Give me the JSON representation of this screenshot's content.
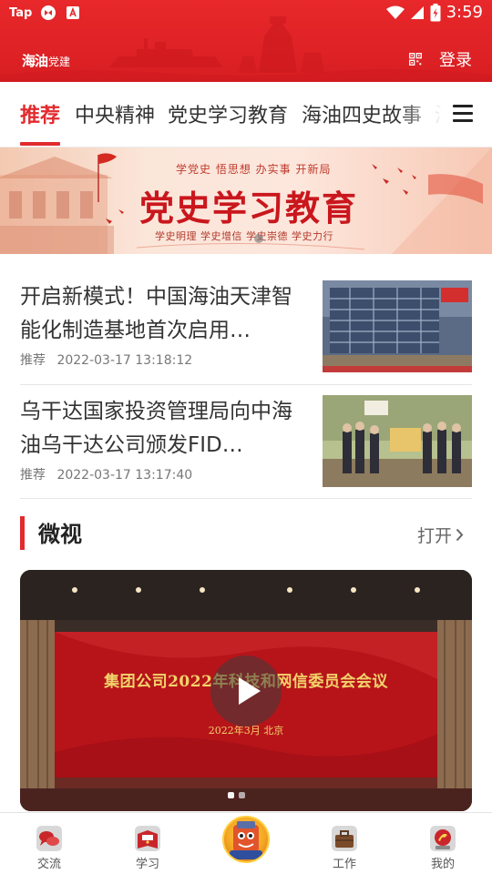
{
  "status_bar": {
    "carrier_text": "Tap",
    "time": "3:59",
    "icons": [
      "app-notification-icon",
      "text-a-icon",
      "wifi-icon",
      "signal-icon",
      "battery-charging-icon"
    ]
  },
  "header": {
    "logo_main": "海油",
    "logo_sub": "党建",
    "qr_icon": "qr-code-icon",
    "login_label": "登录",
    "color": "#e12b2f"
  },
  "tabs": {
    "items": [
      {
        "label": "推荐",
        "active": true
      },
      {
        "label": "中央精神",
        "active": false
      },
      {
        "label": "党史学习教育",
        "active": false
      },
      {
        "label": "海油四史故事",
        "active": false
      },
      {
        "label": "海",
        "active": false
      }
    ],
    "menu_icon": "hamburger-menu-icon",
    "accent": "#e12b2f"
  },
  "banner": {
    "slogan": "学党史  悟思想  办实事  开新局",
    "title": "党史学习教育",
    "subtitle": "学史明理  学史增信  学史崇德  学史力行"
  },
  "news": [
    {
      "title": "开启新模式！中国海油天津智能化制造基地首次启用…",
      "category": "推荐",
      "time": "2022-03-17 13:18:12"
    },
    {
      "title": "乌干达国家投资管理局向中海油乌干达公司颁发FID…",
      "category": "推荐",
      "time": "2022-03-17 13:17:40"
    }
  ],
  "section": {
    "title": "微视",
    "more_label": "打开"
  },
  "video": {
    "caption": "集团公司2022年科技和网信委员会会议",
    "subcaption": "2022年3月  北京",
    "slide_count": 2,
    "active_slide": 1
  },
  "bottom_nav": {
    "items": [
      {
        "label": "交流",
        "icon": "chat-bubbles-icon"
      },
      {
        "label": "学习",
        "icon": "party-book-icon"
      },
      {
        "label": "",
        "icon": "center-cartoon-icon"
      },
      {
        "label": "工作",
        "icon": "work-toolbox-icon"
      },
      {
        "label": "我的",
        "icon": "profile-badge-icon"
      }
    ]
  }
}
